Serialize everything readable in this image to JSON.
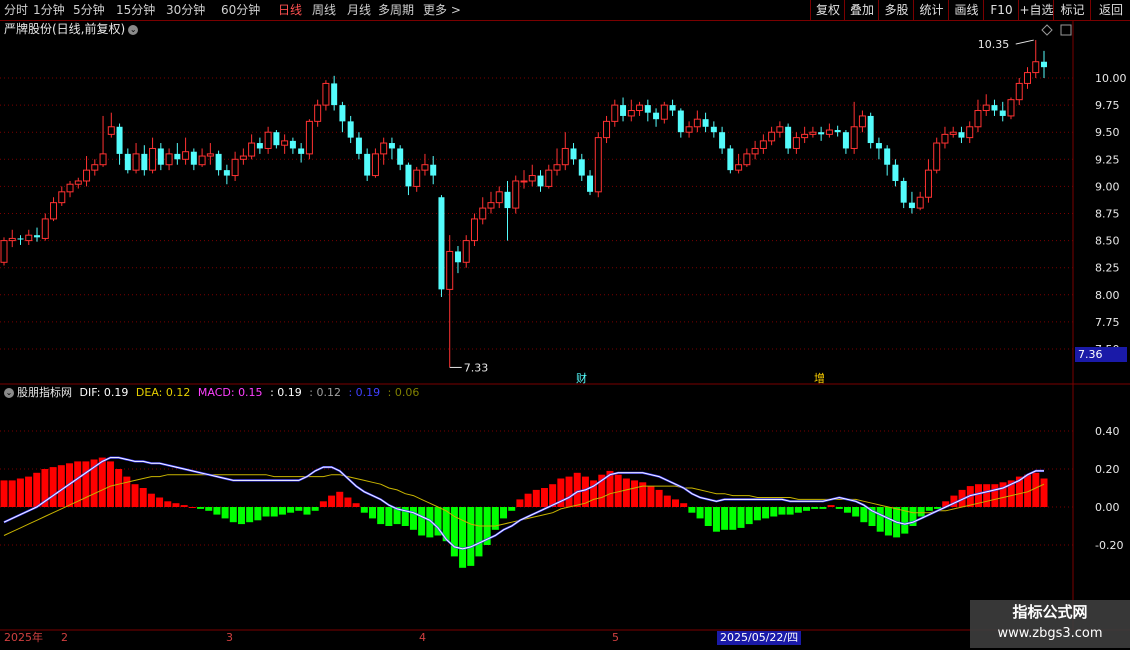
{
  "toolbar": {
    "periods": [
      {
        "label": "分时"
      },
      {
        "label": "1分钟"
      },
      {
        "label": "5分钟"
      },
      {
        "label": "15分钟"
      },
      {
        "label": "30分钟"
      },
      {
        "label": "60分钟"
      },
      {
        "label": "日线",
        "active": true
      },
      {
        "label": "周线"
      },
      {
        "label": "月线"
      },
      {
        "label": "多周期"
      },
      {
        "label": "更多 >"
      }
    ],
    "right_buttons": [
      {
        "label": "复权"
      },
      {
        "label": "叠加"
      },
      {
        "label": "多股"
      },
      {
        "label": "统计"
      },
      {
        "label": "画线"
      },
      {
        "label": "F10"
      },
      {
        "label": "+自选"
      },
      {
        "label": "标记"
      },
      {
        "label": "返回"
      }
    ]
  },
  "chart": {
    "stock_title": "严牌股份(日线,前复权)",
    "y_ticks": [
      "10.00",
      "9.75",
      "9.50",
      "9.25",
      "9.00",
      "8.75",
      "8.50",
      "8.25",
      "8.00",
      "7.75",
      "7.50"
    ],
    "high_marker": "10.35",
    "low_marker": "7.33",
    "current_price": "7.36",
    "event_marks": [
      "财",
      "增"
    ]
  },
  "indicator": {
    "name": "股朋指标网",
    "dif_label": "DIF:",
    "dif_value": "0.19",
    "dea_label": "DEA:",
    "dea_value": "0.12",
    "macd_label": "MACD:",
    "macd_value": "0.15",
    "extra_values": [
      ": 0.19",
      ": 0.12",
      ": 0.19",
      ": 0.06"
    ],
    "y_ticks": [
      "0.40",
      "0.20",
      "0.00",
      "-0.20"
    ]
  },
  "date_axis": {
    "labels": [
      "2025年",
      "2",
      "3",
      "4",
      "5"
    ],
    "cursor_date": "2025/05/22/四"
  },
  "watermark": {
    "line1": "指标公式网",
    "line2": "www.zbgs3.com"
  },
  "colors": {
    "up": "#ff3232",
    "down": "#54fcfc",
    "macd_pos": "#ff0000",
    "macd_neg": "#00ff00",
    "dif": "#ffffff",
    "dea": "#c8b400",
    "grid": "#7a0000"
  },
  "chart_data": {
    "type": "candlestick",
    "ylim": [
      7.5,
      10.35
    ],
    "candles": [
      [
        8.3,
        8.5,
        8.53,
        8.27
      ],
      [
        8.5,
        8.52,
        8.6,
        8.44
      ],
      [
        8.52,
        8.51,
        8.55,
        8.46
      ],
      [
        8.5,
        8.55,
        8.6,
        8.46
      ],
      [
        8.55,
        8.53,
        8.62,
        8.49
      ],
      [
        8.52,
        8.7,
        8.75,
        8.5
      ],
      [
        8.7,
        8.85,
        8.9,
        8.68
      ],
      [
        8.85,
        8.95,
        9.0,
        8.82
      ],
      [
        8.95,
        9.02,
        9.05,
        8.9
      ],
      [
        9.02,
        9.05,
        9.08,
        8.98
      ],
      [
        9.05,
        9.15,
        9.28,
        9.0
      ],
      [
        9.15,
        9.2,
        9.25,
        9.1
      ],
      [
        9.2,
        9.3,
        9.65,
        9.18
      ],
      [
        9.48,
        9.55,
        9.68,
        9.45
      ],
      [
        9.55,
        9.3,
        9.58,
        9.2
      ],
      [
        9.3,
        9.15,
        9.35,
        9.12
      ],
      [
        9.15,
        9.3,
        9.4,
        9.12
      ],
      [
        9.3,
        9.15,
        9.38,
        9.1
      ],
      [
        9.15,
        9.35,
        9.45,
        9.12
      ],
      [
        9.35,
        9.2,
        9.4,
        9.15
      ],
      [
        9.2,
        9.3,
        9.35,
        9.15
      ],
      [
        9.3,
        9.25,
        9.4,
        9.2
      ],
      [
        9.25,
        9.32,
        9.45,
        9.2
      ],
      [
        9.32,
        9.2,
        9.35,
        9.15
      ],
      [
        9.2,
        9.28,
        9.35,
        9.18
      ],
      [
        9.28,
        9.3,
        9.4,
        9.2
      ],
      [
        9.3,
        9.15,
        9.33,
        9.1
      ],
      [
        9.15,
        9.1,
        9.2,
        9.02
      ],
      [
        9.1,
        9.25,
        9.32,
        9.05
      ],
      [
        9.25,
        9.28,
        9.35,
        9.2
      ],
      [
        9.28,
        9.4,
        9.48,
        9.25
      ],
      [
        9.4,
        9.35,
        9.45,
        9.3
      ],
      [
        9.35,
        9.5,
        9.55,
        9.3
      ],
      [
        9.5,
        9.38,
        9.52,
        9.35
      ],
      [
        9.38,
        9.42,
        9.48,
        9.3
      ],
      [
        9.42,
        9.35,
        9.45,
        9.3
      ],
      [
        9.35,
        9.3,
        9.4,
        9.22
      ],
      [
        9.3,
        9.6,
        9.62,
        9.25
      ],
      [
        9.6,
        9.75,
        9.8,
        9.55
      ],
      [
        9.75,
        9.95,
        9.98,
        9.7
      ],
      [
        9.95,
        9.75,
        10.02,
        9.7
      ],
      [
        9.75,
        9.6,
        9.78,
        9.5
      ],
      [
        9.6,
        9.45,
        9.65,
        9.4
      ],
      [
        9.45,
        9.3,
        9.5,
        9.25
      ],
      [
        9.3,
        9.1,
        9.35,
        9.05
      ],
      [
        9.1,
        9.3,
        9.35,
        9.08
      ],
      [
        9.3,
        9.4,
        9.45,
        9.2
      ],
      [
        9.4,
        9.35,
        9.45,
        9.25
      ],
      [
        9.35,
        9.2,
        9.38,
        9.15
      ],
      [
        9.2,
        9.0,
        9.22,
        8.92
      ],
      [
        9.0,
        9.15,
        9.18,
        8.95
      ],
      [
        9.15,
        9.2,
        9.3,
        9.1
      ],
      [
        9.2,
        9.1,
        9.28,
        9.02
      ],
      [
        8.9,
        8.05,
        8.92,
        7.98
      ],
      [
        8.05,
        8.4,
        8.55,
        7.33
      ],
      [
        8.4,
        8.3,
        8.45,
        8.2
      ],
      [
        8.3,
        8.5,
        8.55,
        8.25
      ],
      [
        8.5,
        8.7,
        8.75,
        8.45
      ],
      [
        8.7,
        8.8,
        8.9,
        8.65
      ],
      [
        8.8,
        8.85,
        8.95,
        8.75
      ],
      [
        8.85,
        8.95,
        9.0,
        8.8
      ],
      [
        8.95,
        8.8,
        9.05,
        8.5
      ],
      [
        8.8,
        9.05,
        9.1,
        8.75
      ],
      [
        9.05,
        9.05,
        9.15,
        8.98
      ],
      [
        9.05,
        9.1,
        9.2,
        9.0
      ],
      [
        9.1,
        9.0,
        9.15,
        8.95
      ],
      [
        9.0,
        9.15,
        9.2,
        8.98
      ],
      [
        9.15,
        9.2,
        9.35,
        9.1
      ],
      [
        9.2,
        9.35,
        9.5,
        9.15
      ],
      [
        9.35,
        9.25,
        9.4,
        9.2
      ],
      [
        9.25,
        9.1,
        9.3,
        9.05
      ],
      [
        9.1,
        8.95,
        9.15,
        8.92
      ],
      [
        8.95,
        9.45,
        9.5,
        8.9
      ],
      [
        9.45,
        9.6,
        9.65,
        9.4
      ],
      [
        9.6,
        9.75,
        9.8,
        9.55
      ],
      [
        9.75,
        9.65,
        9.82,
        9.6
      ],
      [
        9.65,
        9.7,
        9.8,
        9.6
      ],
      [
        9.7,
        9.75,
        9.78,
        9.65
      ],
      [
        9.75,
        9.68,
        9.8,
        9.6
      ],
      [
        9.68,
        9.62,
        9.72,
        9.55
      ],
      [
        9.62,
        9.75,
        9.78,
        9.58
      ],
      [
        9.75,
        9.7,
        9.8,
        9.65
      ],
      [
        9.7,
        9.5,
        9.72,
        9.45
      ],
      [
        9.5,
        9.55,
        9.6,
        9.45
      ],
      [
        9.55,
        9.62,
        9.7,
        9.5
      ],
      [
        9.62,
        9.55,
        9.68,
        9.5
      ],
      [
        9.55,
        9.5,
        9.6,
        9.45
      ],
      [
        9.5,
        9.35,
        9.55,
        9.3
      ],
      [
        9.35,
        9.15,
        9.38,
        9.12
      ],
      [
        9.15,
        9.2,
        9.3,
        9.12
      ],
      [
        9.2,
        9.3,
        9.35,
        9.18
      ],
      [
        9.3,
        9.35,
        9.42,
        9.25
      ],
      [
        9.35,
        9.42,
        9.48,
        9.3
      ],
      [
        9.42,
        9.5,
        9.55,
        9.38
      ],
      [
        9.5,
        9.55,
        9.6,
        9.45
      ],
      [
        9.55,
        9.35,
        9.58,
        9.3
      ],
      [
        9.35,
        9.45,
        9.5,
        9.3
      ],
      [
        9.45,
        9.48,
        9.55,
        9.4
      ],
      [
        9.48,
        9.5,
        9.55,
        9.45
      ],
      [
        9.5,
        9.48,
        9.55,
        9.42
      ],
      [
        9.48,
        9.52,
        9.58,
        9.45
      ],
      [
        9.52,
        9.5,
        9.56,
        9.46
      ],
      [
        9.5,
        9.35,
        9.52,
        9.3
      ],
      [
        9.35,
        9.55,
        9.78,
        9.3
      ],
      [
        9.55,
        9.65,
        9.7,
        9.5
      ],
      [
        9.65,
        9.4,
        9.68,
        9.35
      ],
      [
        9.4,
        9.35,
        9.45,
        9.25
      ],
      [
        9.35,
        9.2,
        9.38,
        9.1
      ],
      [
        9.2,
        9.05,
        9.25,
        9.0
      ],
      [
        9.05,
        8.85,
        9.08,
        8.8
      ],
      [
        8.85,
        8.8,
        8.95,
        8.75
      ],
      [
        8.8,
        8.9,
        8.95,
        8.78
      ],
      [
        8.9,
        9.15,
        9.25,
        8.85
      ],
      [
        9.15,
        9.4,
        9.45,
        9.12
      ],
      [
        9.4,
        9.48,
        9.55,
        9.35
      ],
      [
        9.48,
        9.5,
        9.55,
        9.45
      ],
      [
        9.5,
        9.45,
        9.55,
        9.4
      ],
      [
        9.45,
        9.55,
        9.6,
        9.4
      ],
      [
        9.55,
        9.7,
        9.8,
        9.5
      ],
      [
        9.7,
        9.75,
        9.85,
        9.65
      ],
      [
        9.75,
        9.7,
        9.8,
        9.65
      ],
      [
        9.7,
        9.65,
        9.78,
        9.6
      ],
      [
        9.65,
        9.8,
        9.82,
        9.62
      ],
      [
        9.8,
        9.95,
        10.0,
        9.75
      ],
      [
        9.95,
        10.05,
        10.1,
        9.9
      ],
      [
        10.05,
        10.15,
        10.35,
        10.0
      ],
      [
        10.15,
        10.1,
        10.25,
        10.0
      ]
    ],
    "macd_hist": [
      0.14,
      0.14,
      0.15,
      0.16,
      0.18,
      0.2,
      0.21,
      0.22,
      0.23,
      0.24,
      0.24,
      0.25,
      0.26,
      0.24,
      0.2,
      0.16,
      0.12,
      0.1,
      0.07,
      0.05,
      0.03,
      0.02,
      0.01,
      0.0,
      -0.01,
      -0.02,
      -0.04,
      -0.06,
      -0.08,
      -0.09,
      -0.08,
      -0.07,
      -0.05,
      -0.05,
      -0.04,
      -0.03,
      -0.02,
      -0.04,
      -0.02,
      0.03,
      0.06,
      0.08,
      0.05,
      0.02,
      -0.03,
      -0.06,
      -0.09,
      -0.1,
      -0.09,
      -0.1,
      -0.12,
      -0.15,
      -0.16,
      -0.15,
      -0.18,
      -0.26,
      -0.32,
      -0.31,
      -0.26,
      -0.2,
      -0.12,
      -0.06,
      -0.02,
      0.04,
      0.07,
      0.09,
      0.1,
      0.12,
      0.15,
      0.16,
      0.18,
      0.16,
      0.14,
      0.17,
      0.19,
      0.17,
      0.15,
      0.14,
      0.13,
      0.11,
      0.09,
      0.06,
      0.04,
      0.02,
      -0.03,
      -0.06,
      -0.1,
      -0.13,
      -0.12,
      -0.12,
      -0.11,
      -0.09,
      -0.07,
      -0.06,
      -0.05,
      -0.04,
      -0.04,
      -0.03,
      -0.02,
      -0.01,
      -0.01,
      0.01,
      -0.01,
      -0.03,
      -0.05,
      -0.08,
      -0.1,
      -0.13,
      -0.15,
      -0.16,
      -0.14,
      -0.1,
      -0.05,
      -0.02,
      -0.01,
      0.03,
      0.06,
      0.09,
      0.11,
      0.12,
      0.12,
      0.12,
      0.13,
      0.14,
      0.16,
      0.17,
      0.18,
      0.15
    ],
    "dif": [
      -0.08,
      -0.06,
      -0.04,
      -0.02,
      0.0,
      0.03,
      0.06,
      0.09,
      0.12,
      0.15,
      0.18,
      0.21,
      0.24,
      0.26,
      0.26,
      0.25,
      0.24,
      0.24,
      0.23,
      0.23,
      0.22,
      0.21,
      0.2,
      0.19,
      0.18,
      0.17,
      0.16,
      0.15,
      0.14,
      0.14,
      0.14,
      0.14,
      0.14,
      0.14,
      0.14,
      0.14,
      0.14,
      0.16,
      0.19,
      0.21,
      0.21,
      0.19,
      0.15,
      0.11,
      0.08,
      0.06,
      0.04,
      0.01,
      -0.01,
      -0.02,
      -0.03,
      -0.05,
      -0.07,
      -0.11,
      -0.17,
      -0.21,
      -0.22,
      -0.21,
      -0.19,
      -0.17,
      -0.15,
      -0.12,
      -0.1,
      -0.07,
      -0.05,
      -0.03,
      -0.01,
      0.01,
      0.03,
      0.05,
      0.08,
      0.09,
      0.11,
      0.14,
      0.17,
      0.18,
      0.18,
      0.18,
      0.18,
      0.17,
      0.16,
      0.14,
      0.12,
      0.1,
      0.07,
      0.05,
      0.04,
      0.03,
      0.04,
      0.04,
      0.04,
      0.04,
      0.04,
      0.04,
      0.04,
      0.04,
      0.03,
      0.03,
      0.03,
      0.03,
      0.03,
      0.04,
      0.05,
      0.04,
      0.03,
      0.01,
      -0.02,
      -0.04,
      -0.06,
      -0.08,
      -0.09,
      -0.08,
      -0.06,
      -0.04,
      -0.02,
      0.0,
      0.02,
      0.04,
      0.06,
      0.07,
      0.08,
      0.09,
      0.1,
      0.12,
      0.14,
      0.17,
      0.19,
      0.19
    ],
    "dea": [
      -0.15,
      -0.13,
      -0.11,
      -0.09,
      -0.07,
      -0.05,
      -0.03,
      -0.01,
      0.01,
      0.03,
      0.05,
      0.07,
      0.09,
      0.11,
      0.12,
      0.13,
      0.14,
      0.15,
      0.16,
      0.16,
      0.17,
      0.17,
      0.17,
      0.17,
      0.17,
      0.17,
      0.17,
      0.17,
      0.17,
      0.17,
      0.17,
      0.17,
      0.17,
      0.16,
      0.16,
      0.16,
      0.16,
      0.16,
      0.16,
      0.16,
      0.17,
      0.17,
      0.16,
      0.15,
      0.14,
      0.13,
      0.12,
      0.1,
      0.09,
      0.07,
      0.06,
      0.04,
      0.02,
      0.0,
      -0.02,
      -0.05,
      -0.07,
      -0.09,
      -0.1,
      -0.1,
      -0.1,
      -0.09,
      -0.08,
      -0.07,
      -0.06,
      -0.05,
      -0.04,
      -0.03,
      -0.01,
      0.0,
      0.01,
      0.02,
      0.04,
      0.05,
      0.07,
      0.08,
      0.09,
      0.1,
      0.11,
      0.11,
      0.11,
      0.11,
      0.11,
      0.1,
      0.1,
      0.09,
      0.08,
      0.07,
      0.07,
      0.06,
      0.06,
      0.06,
      0.05,
      0.05,
      0.05,
      0.05,
      0.05,
      0.04,
      0.04,
      0.04,
      0.04,
      0.04,
      0.04,
      0.04,
      0.04,
      0.03,
      0.02,
      0.01,
      0.0,
      -0.01,
      -0.02,
      -0.03,
      -0.03,
      -0.03,
      -0.02,
      -0.02,
      -0.01,
      0.0,
      0.01,
      0.02,
      0.03,
      0.04,
      0.05,
      0.06,
      0.07,
      0.08,
      0.1,
      0.12
    ]
  }
}
